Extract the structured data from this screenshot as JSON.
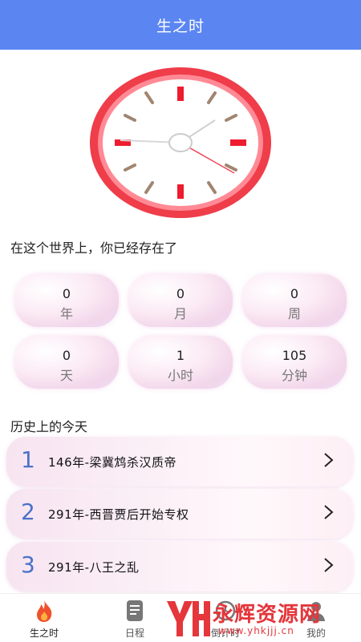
{
  "header": {
    "title": "生之时"
  },
  "clock": {
    "hour_marks": 12,
    "accent": "#ee3344"
  },
  "subtitle": "在这个世界上，你已经存在了",
  "stats": [
    {
      "value": "0",
      "unit": "年"
    },
    {
      "value": "0",
      "unit": "月"
    },
    {
      "value": "0",
      "unit": "周"
    },
    {
      "value": "0",
      "unit": "天"
    },
    {
      "value": "1",
      "unit": "小时"
    },
    {
      "value": "105",
      "unit": "分钟"
    }
  ],
  "history": {
    "title": "历史上的今天",
    "items": [
      {
        "index": "1",
        "text": "146年-梁冀鸩杀汉质帝"
      },
      {
        "index": "2",
        "text": "291年-西晋贾后开始专权"
      },
      {
        "index": "3",
        "text": "291年-八王之乱"
      }
    ]
  },
  "tabbar": {
    "items": [
      {
        "label": "生之时",
        "icon": "flame-icon"
      },
      {
        "label": "日程",
        "icon": "note-icon"
      },
      {
        "label": "倒计时",
        "icon": "clock-icon"
      },
      {
        "label": "我的",
        "icon": "user-icon"
      }
    ]
  },
  "watermark": {
    "brand": "永辉资源网",
    "url": "www.yhkjjj.cn"
  },
  "colors": {
    "header": "#5b86f2",
    "index": "#4a72c8",
    "clock_ring": "#ee3344"
  }
}
